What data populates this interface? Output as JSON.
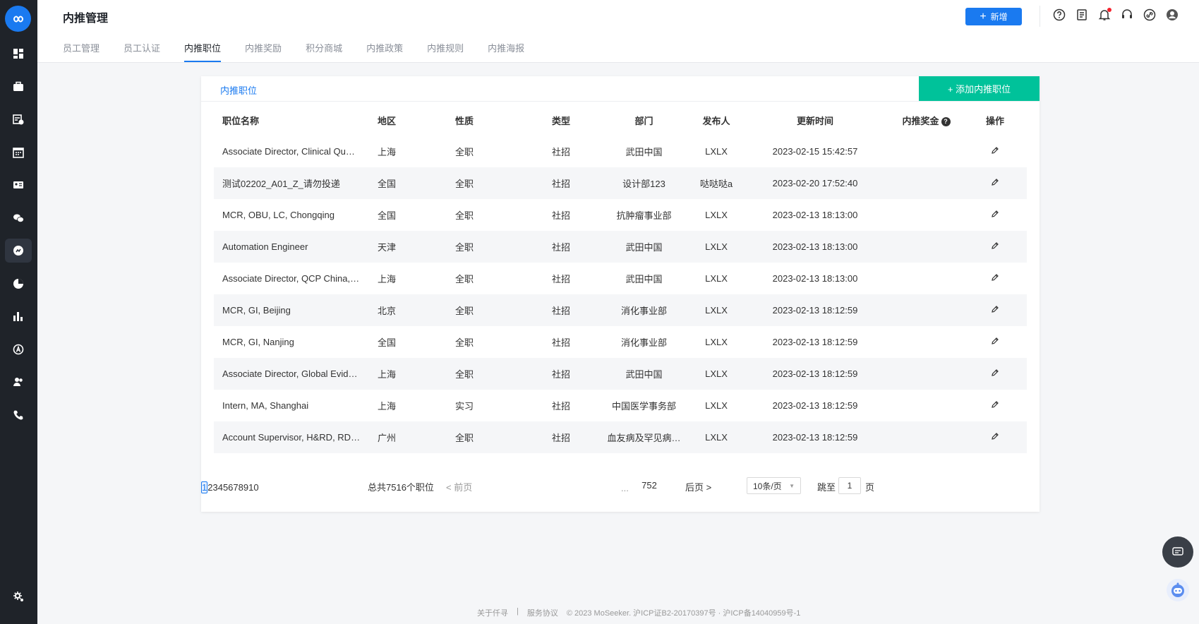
{
  "app": {
    "logo_text": "MoSeeker"
  },
  "header": {
    "title": "内推管理",
    "new_button": "新增",
    "tabs": [
      {
        "label": "员工管理",
        "active": false
      },
      {
        "label": "员工认证",
        "active": false
      },
      {
        "label": "内推职位",
        "active": true
      },
      {
        "label": "内推奖励",
        "active": false
      },
      {
        "label": "积分商城",
        "active": false
      },
      {
        "label": "内推政策",
        "active": false
      },
      {
        "label": "内推规则",
        "active": false
      },
      {
        "label": "内推海报",
        "active": false
      }
    ]
  },
  "sidebar": {
    "items": [
      {
        "icon": "dashboard-icon"
      },
      {
        "icon": "briefcase-icon"
      },
      {
        "icon": "schedule-icon"
      },
      {
        "icon": "calendar-icon"
      },
      {
        "icon": "id-card-icon"
      },
      {
        "icon": "wechat-icon"
      },
      {
        "icon": "referral-icon",
        "active": true
      },
      {
        "icon": "pie-chart-icon"
      },
      {
        "icon": "bar-chart-icon"
      },
      {
        "icon": "circle-a-icon"
      },
      {
        "icon": "users-icon"
      },
      {
        "icon": "phone-icon"
      }
    ],
    "bottom_icon": "settings-icon"
  },
  "card": {
    "tab": "内推职位",
    "add_button": "+ 添加内推职位"
  },
  "table": {
    "columns": [
      "职位名称",
      "地区",
      "性质",
      "类型",
      "部门",
      "发布人",
      "更新时间",
      "内推奖金",
      "操作"
    ],
    "rows": [
      {
        "name": "Associate Director, Clinical Qu…",
        "region": "上海",
        "nature": "全职",
        "type": "社招",
        "dept": "武田中国",
        "publisher": "LXLX",
        "time": "2023-02-15 15:42:57",
        "bonus": ""
      },
      {
        "name": "测试02202_A01_Z_请勿投递",
        "region": "全国",
        "nature": "全职",
        "type": "社招",
        "dept": "设计部123",
        "publisher": "哒哒哒a",
        "time": "2023-02-20 17:52:40",
        "bonus": ""
      },
      {
        "name": "MCR, OBU, LC, Chongqing",
        "region": "全国",
        "nature": "全职",
        "type": "社招",
        "dept": "抗肿瘤事业部",
        "publisher": "LXLX",
        "time": "2023-02-13 18:13:00",
        "bonus": ""
      },
      {
        "name": "Automation Engineer",
        "region": "天津",
        "nature": "全职",
        "type": "社招",
        "dept": "武田中国",
        "publisher": "LXLX",
        "time": "2023-02-13 18:13:00",
        "bonus": ""
      },
      {
        "name": "Associate Director, QCP China,…",
        "region": "上海",
        "nature": "全职",
        "type": "社招",
        "dept": "武田中国",
        "publisher": "LXLX",
        "time": "2023-02-13 18:13:00",
        "bonus": ""
      },
      {
        "name": "MCR, GI, Beijing",
        "region": "北京",
        "nature": "全职",
        "type": "社招",
        "dept": "消化事业部",
        "publisher": "LXLX",
        "time": "2023-02-13 18:12:59",
        "bonus": ""
      },
      {
        "name": "MCR, GI, Nanjing",
        "region": "全国",
        "nature": "全职",
        "type": "社招",
        "dept": "消化事业部",
        "publisher": "LXLX",
        "time": "2023-02-13 18:12:59",
        "bonus": ""
      },
      {
        "name": "Associate Director, Global Evid…",
        "region": "上海",
        "nature": "全职",
        "type": "社招",
        "dept": "武田中国",
        "publisher": "LXLX",
        "time": "2023-02-13 18:12:59",
        "bonus": ""
      },
      {
        "name": "Intern, MA, Shanghai",
        "region": "上海",
        "nature": "实习",
        "type": "社招",
        "dept": "中国医学事务部",
        "publisher": "LXLX",
        "time": "2023-02-13 18:12:59",
        "bonus": ""
      },
      {
        "name": "Account Supervisor, H&RD, RD…",
        "region": "广州",
        "nature": "全职",
        "type": "社招",
        "dept": "血友病及罕见病…",
        "publisher": "LXLX",
        "time": "2023-02-13 18:12:59",
        "bonus": ""
      }
    ]
  },
  "pagination": {
    "total": "总共7516个职位",
    "prev": "< 前页",
    "pages": [
      "1",
      "2",
      "3",
      "4",
      "5",
      "6",
      "7",
      "8",
      "9",
      "10"
    ],
    "current": "1",
    "ellipsis": "...",
    "last": "752",
    "next": "后页 >",
    "page_size": "10条/页",
    "jump_label": "跳至",
    "jump_value": "1",
    "jump_unit": "页"
  },
  "footer": {
    "about": "关于仟寻",
    "sep": "|",
    "terms": "服务协议",
    "copyright": "© 2023 MoSeeker. 沪ICP证B2-20170397号 · 沪ICP备14040959号-1"
  },
  "colors": {
    "primary": "#1a7af0",
    "add_button": "#00c29a",
    "sidebar": "#1f2329"
  }
}
